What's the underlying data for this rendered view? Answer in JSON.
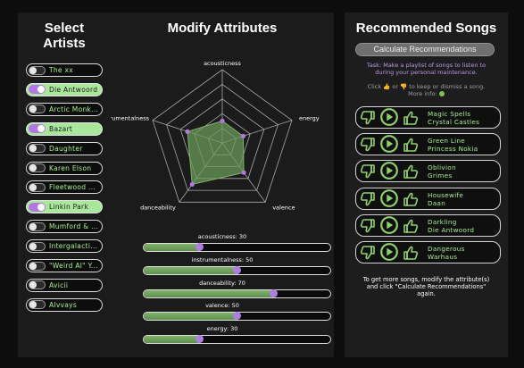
{
  "left": {
    "title_line1": "Select",
    "title_line2": "Artists",
    "artists": [
      {
        "label": "The xx",
        "selected": false
      },
      {
        "label": "Die Antwoord",
        "selected": true
      },
      {
        "label": "Arctic Monk...",
        "selected": false
      },
      {
        "label": "Bazart",
        "selected": true
      },
      {
        "label": "Daughter",
        "selected": false
      },
      {
        "label": "Karen Elson",
        "selected": false
      },
      {
        "label": "Fleetwood ...",
        "selected": false
      },
      {
        "label": "Linkin Park",
        "selected": true
      },
      {
        "label": "Mumford & ...",
        "selected": false
      },
      {
        "label": "Intergalacti...",
        "selected": false
      },
      {
        "label": "\"Weird Al\" Y...",
        "selected": false
      },
      {
        "label": "Avicii",
        "selected": false
      },
      {
        "label": "Alvvays",
        "selected": false
      }
    ]
  },
  "middle": {
    "title": "Modify Attributes",
    "radar_axes": [
      "acousticness",
      "energy",
      "valence",
      "danceability",
      "instrumentalness"
    ],
    "attributes": [
      {
        "name": "acousticness",
        "label": "acousticness: 30",
        "value": 30
      },
      {
        "name": "instrumentalness",
        "label": "instrumentalness: 50",
        "value": 50
      },
      {
        "name": "danceability",
        "label": "danceability: 70",
        "value": 70
      },
      {
        "name": "valence",
        "label": "valence: 50",
        "value": 50
      },
      {
        "name": "energy",
        "label": "energy: 30",
        "value": 30
      }
    ]
  },
  "right": {
    "title": "Recommended Songs",
    "calculate_label": "Calculate Recommendations",
    "task_line1": "Task: Make a playlist of songs to listen to",
    "task_line2": "during your personal maintenance.",
    "click_prefix": "Click",
    "click_up_glyph": "👍",
    "click_or": "or",
    "click_down_glyph": "👎",
    "click_suffix": "to keep or dismiss a song.",
    "more_info": "More info:",
    "songs": [
      {
        "title": "Magic Spells",
        "artist": "Crystal Castles"
      },
      {
        "title": "Green Line",
        "artist": "Princess Nokia"
      },
      {
        "title": "Oblivion",
        "artist": "Grimes"
      },
      {
        "title": "Housewife",
        "artist": "Daan"
      },
      {
        "title": "Darkling",
        "artist": "Die Antwoord"
      },
      {
        "title": "Dangerous",
        "artist": "Warhaus"
      }
    ],
    "footer_line1": "To get more songs, modify the attribute(s)",
    "footer_line2": "and click \"Calculate Recommendations\"",
    "footer_line3": "again."
  },
  "colors": {
    "accent_green": "#a6ee8e",
    "accent_purple": "#b277e3",
    "radar_fill": "#6a9a5a"
  },
  "icons": {
    "thumbs_down": "thumbs-down-icon",
    "play": "play-icon",
    "thumbs_up": "thumbs-up-icon",
    "info": "info-icon"
  }
}
